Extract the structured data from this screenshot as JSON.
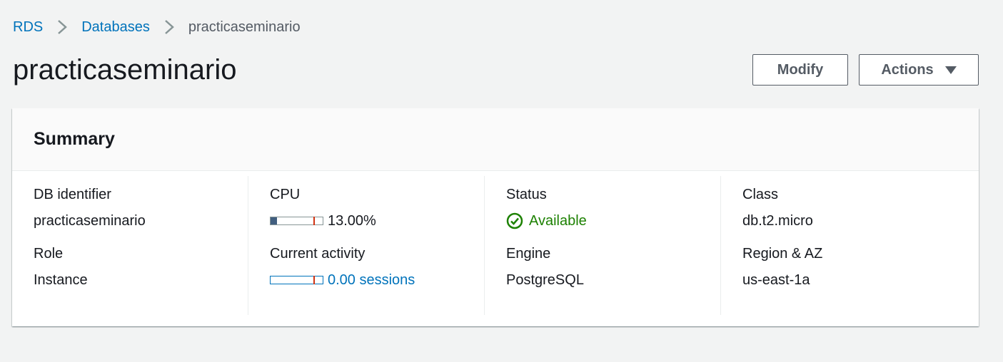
{
  "breadcrumb": {
    "items": [
      "RDS",
      "Databases",
      "practicaseminario"
    ]
  },
  "page": {
    "title": "practicaseminario"
  },
  "buttons": {
    "modify": "Modify",
    "actions": "Actions"
  },
  "summary": {
    "heading": "Summary",
    "db_identifier": {
      "label": "DB identifier",
      "value": "practicaseminario"
    },
    "role": {
      "label": "Role",
      "value": "Instance"
    },
    "cpu": {
      "label": "CPU",
      "value": "13.00%",
      "level_percent": 13
    },
    "current_activity": {
      "label": "Current activity",
      "value": "0.00 sessions",
      "level_percent": 0
    },
    "status": {
      "label": "Status",
      "value": "Available",
      "icon": "check-circle-icon"
    },
    "engine": {
      "label": "Engine",
      "value": "PostgreSQL"
    },
    "class": {
      "label": "Class",
      "value": "db.t2.micro"
    },
    "region_az": {
      "label": "Region & AZ",
      "value": "us-east-1a"
    }
  },
  "colors": {
    "link": "#0073bb",
    "status_ok": "#1d8102",
    "meter_fill": "#415e7f",
    "meter_threshold": "#d13212"
  }
}
